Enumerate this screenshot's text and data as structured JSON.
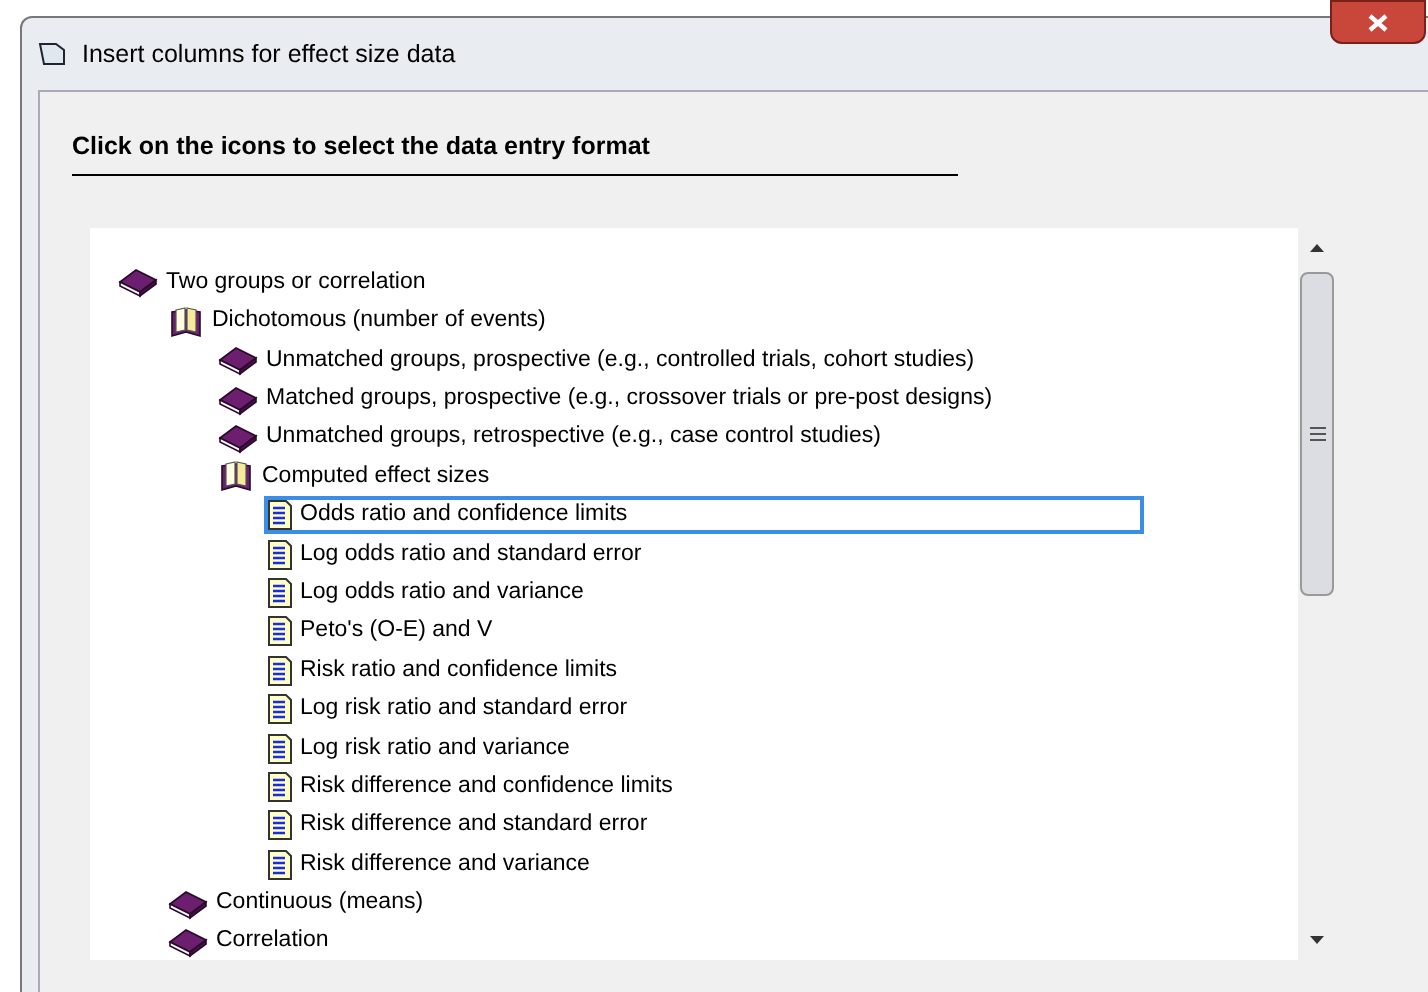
{
  "window": {
    "title": "Insert columns for effect size data"
  },
  "heading": "Click on the icons to select the data entry format",
  "tree": [
    {
      "label": "Two groups or correlation",
      "kind": "book",
      "selected": false,
      "children": [
        {
          "label": "Dichotomous (number of events)",
          "kind": "open-book",
          "selected": false,
          "children": [
            {
              "label": "Unmatched groups, prospective (e.g., controlled trials, cohort studies)",
              "kind": "book",
              "selected": false
            },
            {
              "label": "Matched groups, prospective (e.g., crossover trials or pre-post designs)",
              "kind": "book",
              "selected": false
            },
            {
              "label": "Unmatched groups, retrospective (e.g., case control studies)",
              "kind": "book",
              "selected": false
            },
            {
              "label": "Computed effect sizes",
              "kind": "open-book",
              "selected": false,
              "children": [
                {
                  "label": "Odds ratio and confidence limits",
                  "kind": "document",
                  "selected": true
                },
                {
                  "label": "Log odds ratio and standard error",
                  "kind": "document",
                  "selected": false
                },
                {
                  "label": "Log odds ratio and variance",
                  "kind": "document",
                  "selected": false
                },
                {
                  "label": "Peto's (O-E) and V",
                  "kind": "document",
                  "selected": false
                },
                {
                  "label": "Risk ratio and confidence limits",
                  "kind": "document",
                  "selected": false
                },
                {
                  "label": "Log risk ratio and standard error",
                  "kind": "document",
                  "selected": false
                },
                {
                  "label": "Log risk ratio and variance",
                  "kind": "document",
                  "selected": false
                },
                {
                  "label": "Risk difference and confidence limits",
                  "kind": "document",
                  "selected": false
                },
                {
                  "label": "Risk difference and standard error",
                  "kind": "document",
                  "selected": false
                },
                {
                  "label": "Risk difference and variance",
                  "kind": "document",
                  "selected": false
                }
              ]
            }
          ]
        },
        {
          "label": "Continuous (means)",
          "kind": "book",
          "selected": false
        },
        {
          "label": "Correlation",
          "kind": "book",
          "selected": false
        }
      ]
    }
  ]
}
